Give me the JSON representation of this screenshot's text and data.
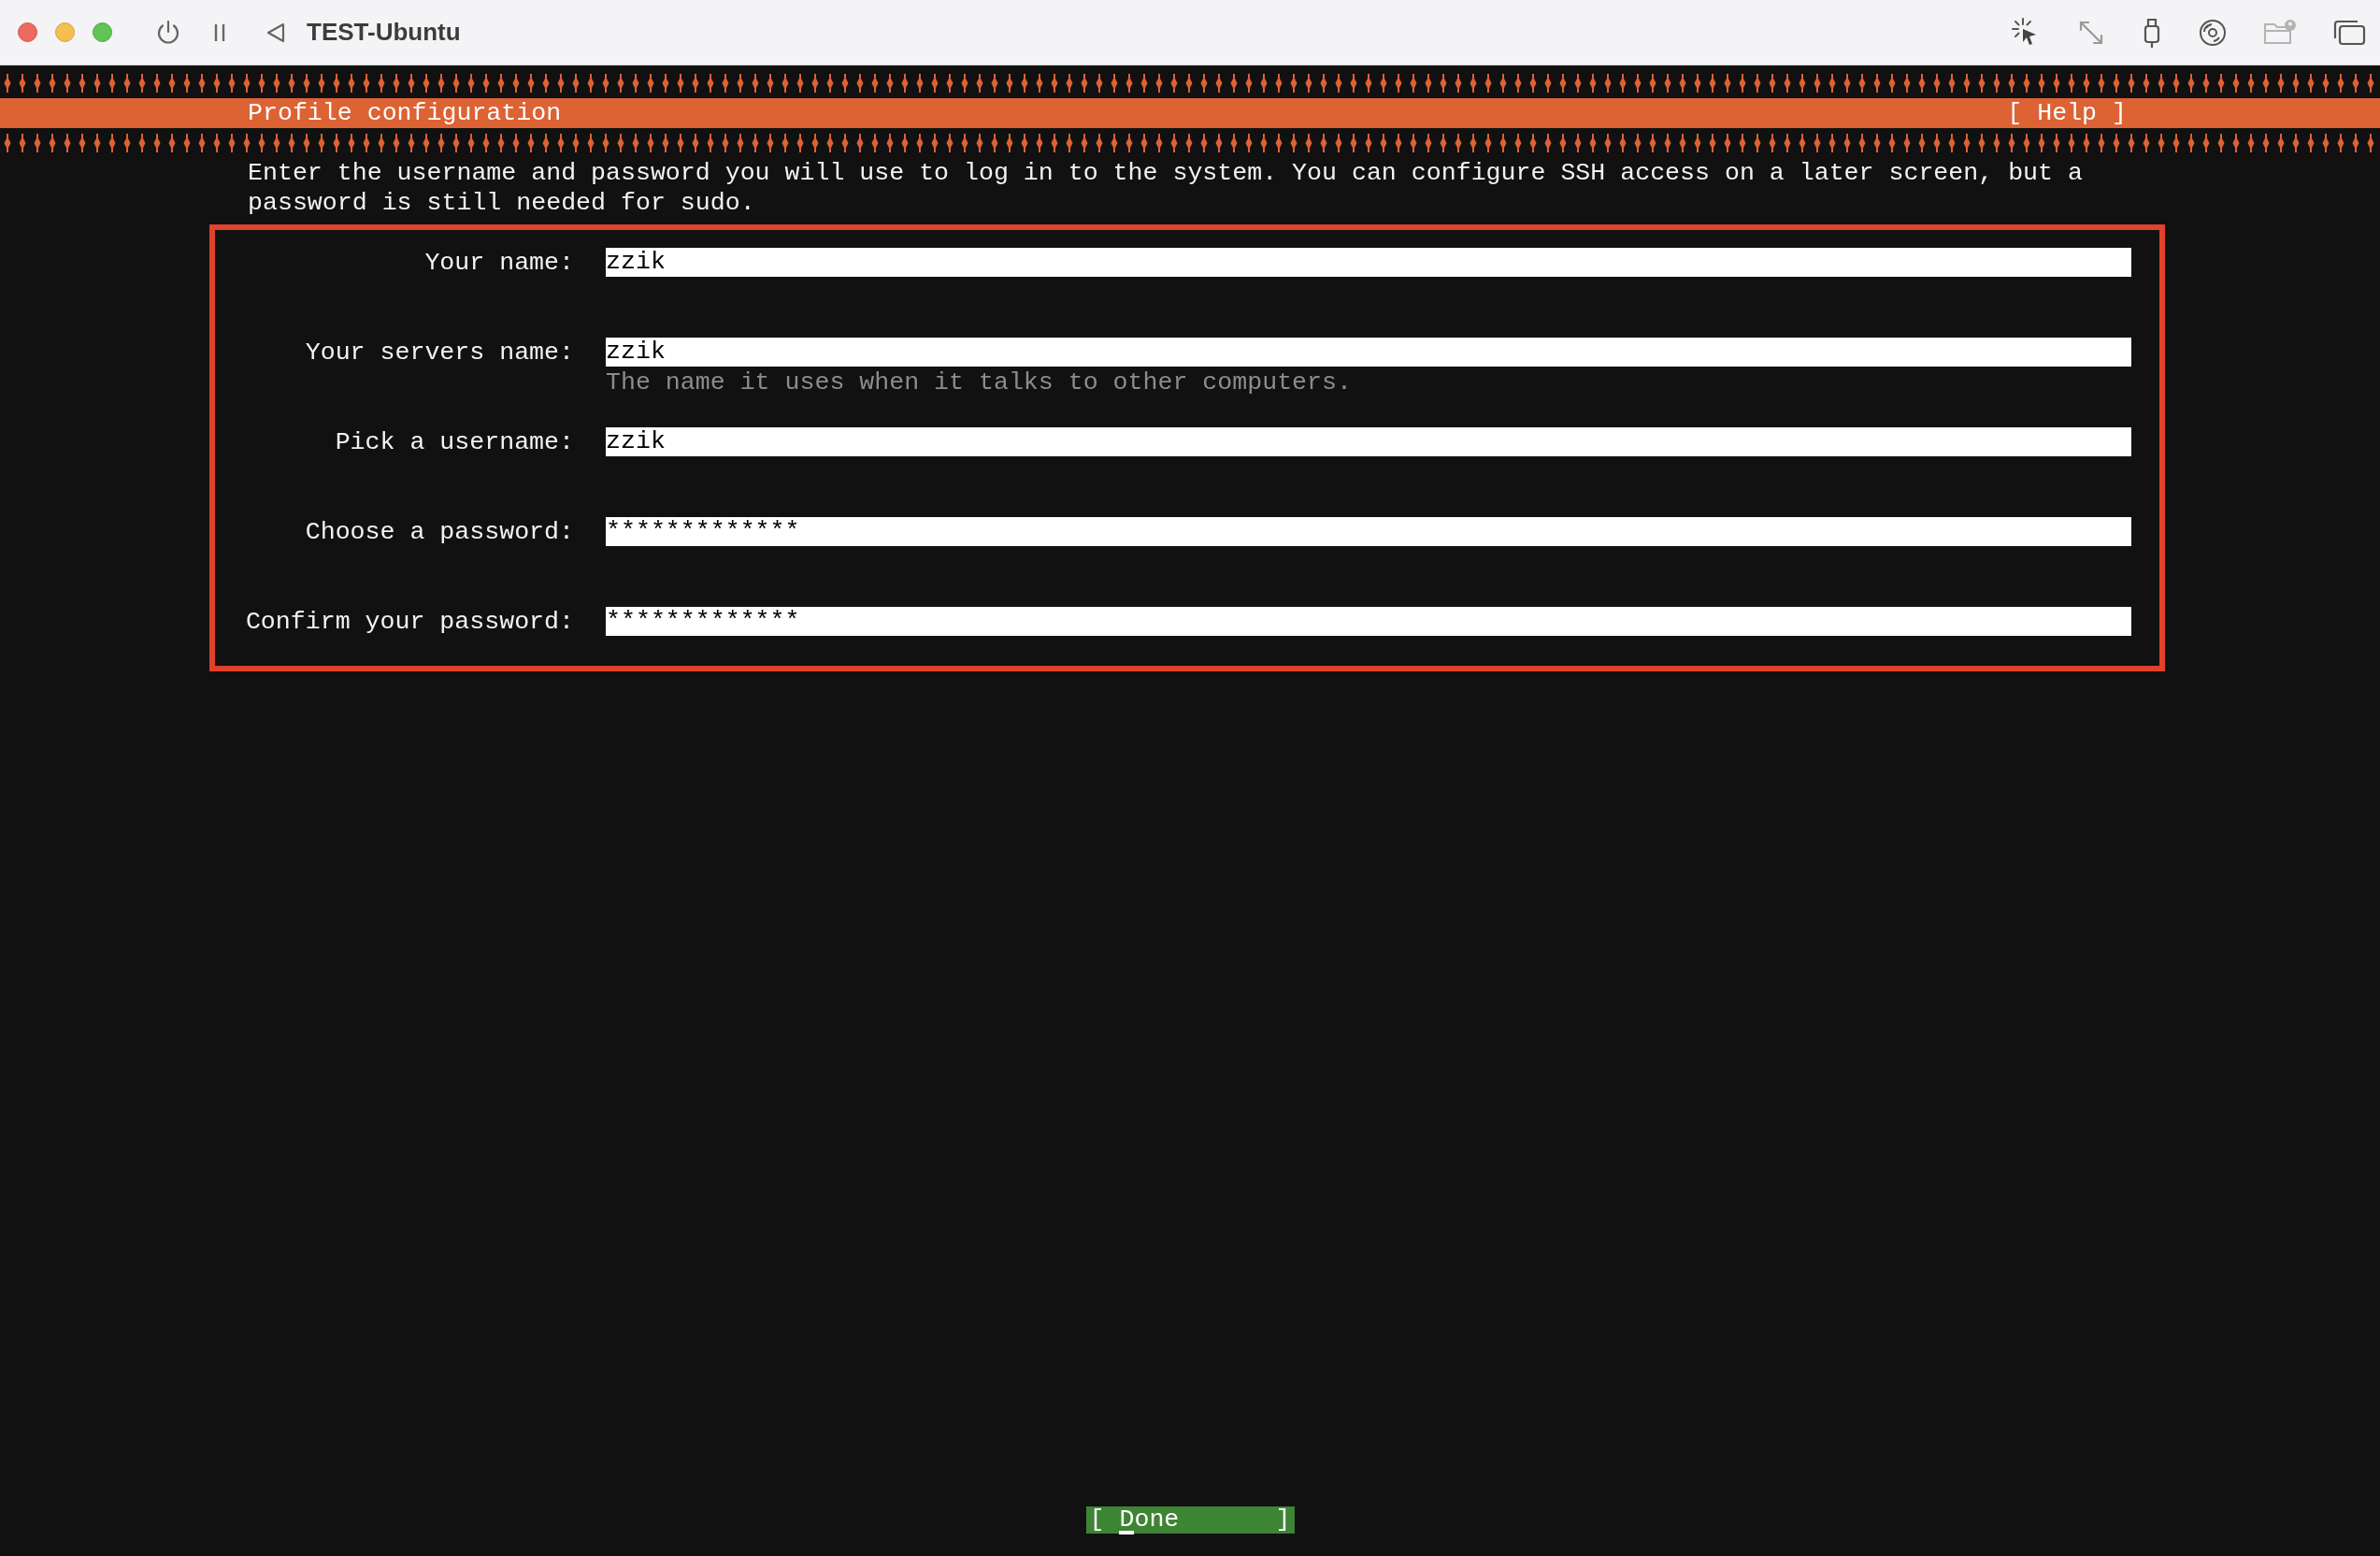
{
  "window": {
    "title": "TEST-Ubuntu"
  },
  "header": {
    "title": "Profile configuration",
    "help": "[ Help ]"
  },
  "intro": "Enter the username and password you will use to log in to the system. You can configure SSH access on a later screen, but a password is still needed for sudo.",
  "fields": [
    {
      "label": "Your name:",
      "value": "zzik"
    },
    {
      "label": "Your servers name:",
      "value": "zzik",
      "hint": "The name it uses when it talks to other computers."
    },
    {
      "label": "Pick a username:",
      "value": "zzik"
    },
    {
      "label": "Choose a password:",
      "value": "*************"
    },
    {
      "label": "Confirm your password:",
      "value": "*************"
    }
  ],
  "done_button": {
    "label": "Done",
    "brackets": [
      "[",
      "]"
    ]
  }
}
